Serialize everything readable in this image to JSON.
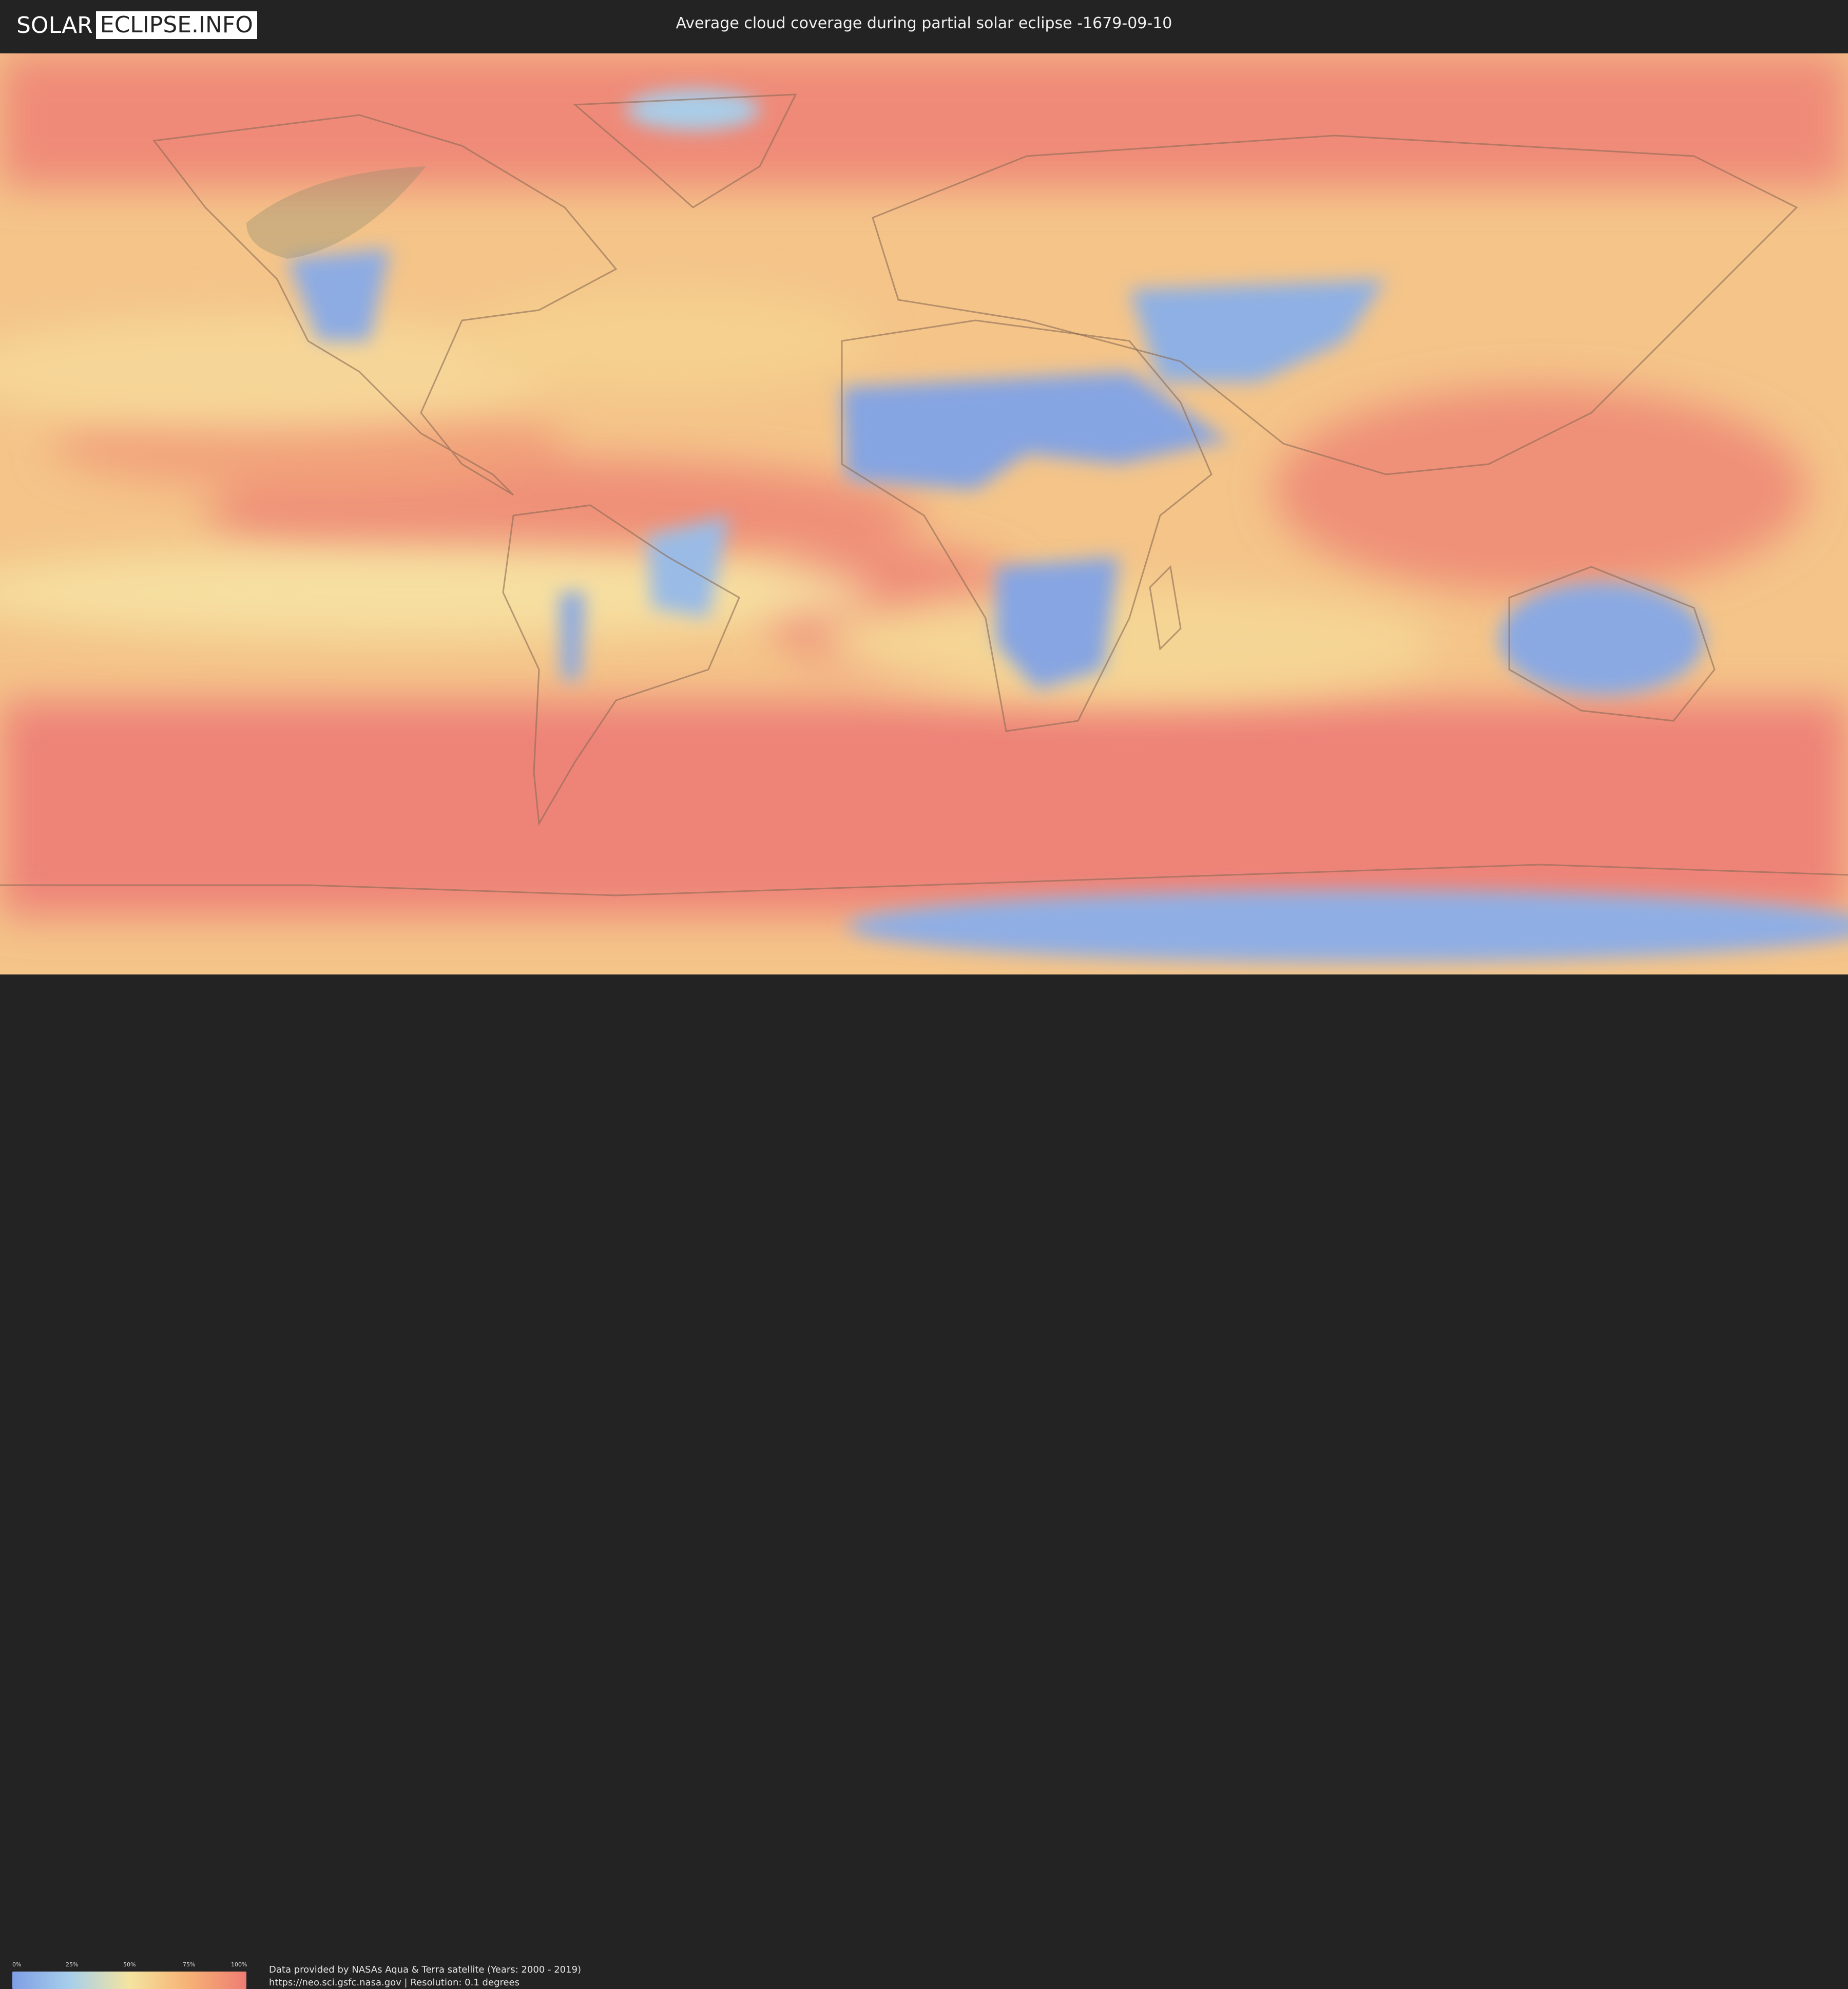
{
  "header": {
    "logo_left": "SOLAR",
    "logo_right": "ECLIPSE.INFO",
    "title": "Average cloud coverage during partial solar eclipse -1679-09-10"
  },
  "legend": {
    "ticks": [
      "0%",
      "25%",
      "50%",
      "75%",
      "100%"
    ],
    "colors": [
      "#7f9ee6",
      "#a8d0ea",
      "#f4e4a0",
      "#f6b275",
      "#ee7d74"
    ]
  },
  "footer": {
    "line1": "Data provided by NASAs Aqua & Terra satellite (Years: 2000 - 2019)",
    "line2": "https://neo.sci.gsfc.nasa.gov | Resolution: 0.1 degrees"
  },
  "colors": {
    "clear": "#7f9ee6",
    "low": "#a8d0ea",
    "medium": "#f4e4a0",
    "high": "#f6b275",
    "overcast": "#ee7d74"
  }
}
